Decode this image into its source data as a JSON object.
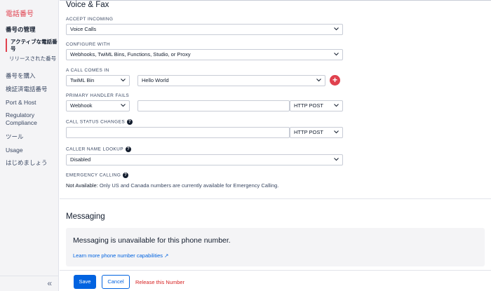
{
  "sidebar": {
    "brand": "電話番号",
    "manage_heading": "番号の管理",
    "active_numbers": "アクティブな電話番号",
    "released_numbers": "リリースされた番号",
    "items": [
      "番号を購入",
      "検証済電話番号",
      "Port & Host",
      "Regulatory Compliance",
      "ツール",
      "Usage",
      "はじめましょう"
    ],
    "collapse_glyph": "«"
  },
  "voice": {
    "title": "Voice & Fax",
    "accept_incoming_label": "ACCEPT INCOMING",
    "accept_incoming_value": "Voice Calls",
    "configure_with_label": "CONFIGURE WITH",
    "configure_with_value": "Webhooks, TwiML Bins, Functions, Studio, or Proxy",
    "call_comes_in_label": "A CALL COMES IN",
    "call_comes_in_type": "TwiML Bin",
    "call_comes_in_bin": "Hello World",
    "add_glyph": "+",
    "primary_fails_label": "PRIMARY HANDLER FAILS",
    "primary_fails_type": "Webhook",
    "primary_fails_url": "",
    "primary_fails_method": "HTTP POST",
    "status_changes_label": "CALL STATUS CHANGES",
    "status_changes_url": "",
    "status_changes_method": "HTTP POST",
    "caller_lookup_label": "CALLER NAME LOOKUP",
    "caller_lookup_value": "Disabled",
    "emergency_label": "EMERGENCY CALLING",
    "emergency_note_prefix": "Not Available:",
    "emergency_note": "Only US and Canada numbers are currently available for Emergency Calling.",
    "help_glyph": "?"
  },
  "messaging": {
    "title": "Messaging",
    "unavailable": "Messaging is unavailable for this phone number.",
    "learn_more": "Learn more phone number capabilities ↗"
  },
  "footer": {
    "save": "Save",
    "cancel": "Cancel",
    "release": "Release this Number"
  },
  "colors": {
    "brand_red": "#e0414e",
    "primary_blue": "#0263e0",
    "danger_red": "#d61f1f"
  }
}
